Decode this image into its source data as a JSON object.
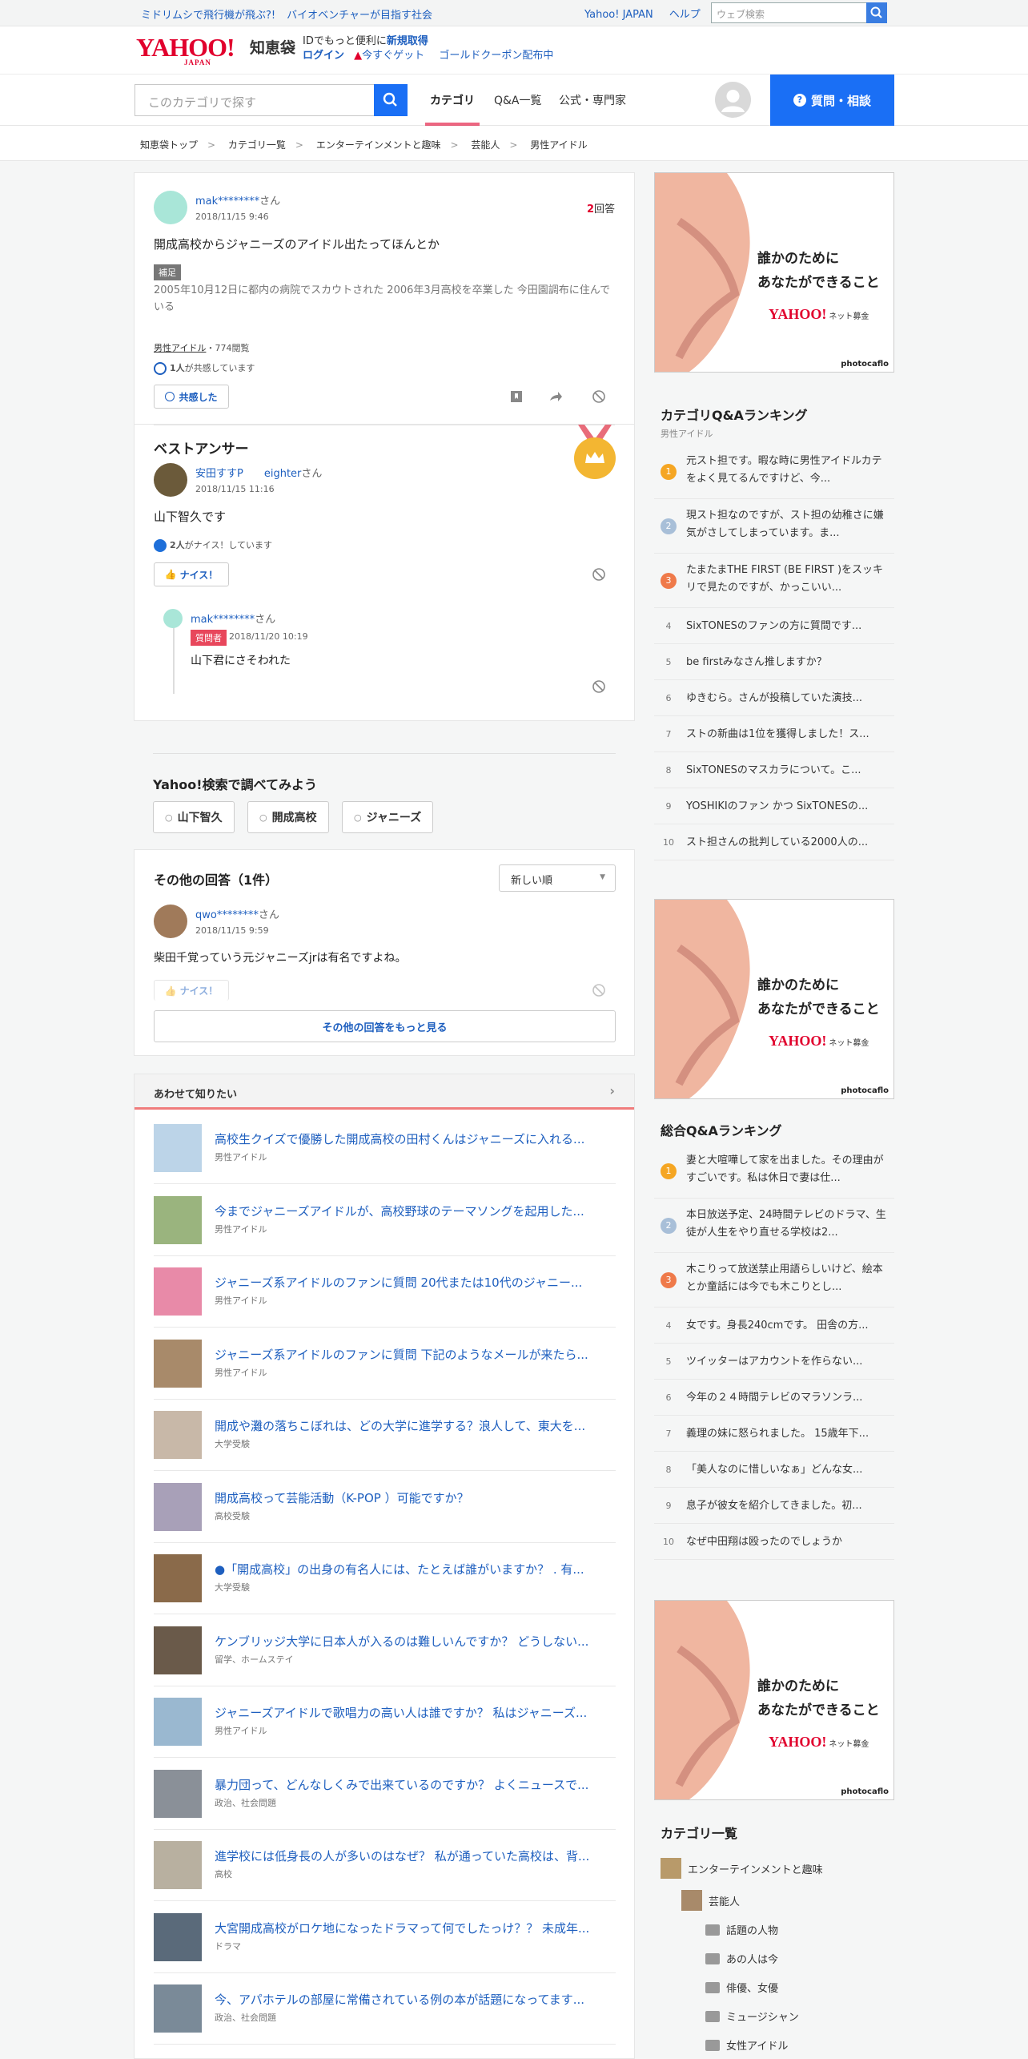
{
  "topbar": {
    "promo1": "ミドリムシで飛行機が飛ぶ?!",
    "promo2": "バイオベンチャーが目指す社会",
    "link1": "Yahoo! JAPAN",
    "link2": "ヘルプ",
    "search_placeholder": "ウェブ検索"
  },
  "header": {
    "logo": "YAHOO!",
    "logo_sub": "JAPAN",
    "service": "知恵袋",
    "promo_a": "IDでもっと便利に",
    "promo_b": "新規取得",
    "login": "ログイン",
    "get": "今すぐゲット",
    "gold": "ゴールドクーポン配布中"
  },
  "nav": {
    "search_placeholder": "このカテゴリで探す",
    "tab1": "カテゴリ",
    "tab2": "Q&A一覧",
    "tab3": "公式・専門家",
    "ask": "質問・相談"
  },
  "breadcrumb": [
    "知恵袋トップ",
    "カテゴリ一覧",
    "エンターテインメントと趣味",
    "芸能人",
    "男性アイドル"
  ],
  "question": {
    "user": "mak********",
    "san": "さん",
    "date": "2018/11/15 9:46",
    "answers_n": "2",
    "answers_label": "回答",
    "title": "開成高校からジャニーズのアイドル出たってほんとか",
    "supp_tag": "補足",
    "supp": "2005年10月12日に都内の病院でスカウトされた 2006年3月高校を卒業した 今田園調布に住んでいる",
    "category": "男性アイドル",
    "views": "・774閲覧",
    "empathy_n": "1人",
    "empathy_text": "が共感しています",
    "empathy_btn": "共感した"
  },
  "best": {
    "heading": "ベストアンサー",
    "user1": "安田すすP",
    "user2": "eighter",
    "san": "さん",
    "date": "2018/11/15 11:16",
    "text": "山下智久です",
    "nice_n": "2人",
    "nice_text": "がナイス！しています",
    "nice_btn": "ナイス！",
    "reply_user": "mak********",
    "reply_san": "さん",
    "reply_badge": "質問者",
    "reply_date": "2018/11/20 10:19",
    "reply_text": "山下君にさそわれた"
  },
  "search_section": {
    "title": "Yahoo!検索で調べてみよう",
    "chips": [
      "山下智久",
      "開成高校",
      "ジャニーズ"
    ]
  },
  "other": {
    "title": "その他の回答（1件）",
    "sort": "新しい順",
    "user": "qwo********",
    "san": "さん",
    "date": "2018/11/15 9:59",
    "text": "柴田千覚っていう元ジャニーズjrは有名ですよね。",
    "nice_btn": "ナイス！",
    "more": "その他の回答をもっと見る"
  },
  "related": {
    "title": "あわせて知りたい",
    "items": [
      {
        "t": "高校生クイズで優勝した開成高校の田村くんはジャニーズに入れる...",
        "c": "男性アイドル",
        "color": "#bcd4e8"
      },
      {
        "t": "今までジャニーズアイドルが、高校野球のテーマソングを起用した...",
        "c": "男性アイドル",
        "color": "#9ab47e"
      },
      {
        "t": "ジャニーズ系アイドルのファンに質問 20代または10代のジャニー...",
        "c": "男性アイドル",
        "color": "#e88aa8"
      },
      {
        "t": "ジャニーズ系アイドルのファンに質問 下記のようなメールが来たら...",
        "c": "男性アイドル",
        "color": "#a88a6a"
      },
      {
        "t": "開成や灘の落ちこぼれは、どの大学に進学する？浪人して、東大を...",
        "c": "大学受験",
        "color": "#c8b8a8"
      },
      {
        "t": "開成高校って芸能活動（K-POP ）可能ですか？",
        "c": "高校受験",
        "color": "#a8a0b8"
      },
      {
        "t": "●「開成高校」の出身の有名人には、たとえば誰がいますか？ . 有...",
        "c": "大学受験",
        "color": "#8a6a4a"
      },
      {
        "t": "ケンブリッジ大学に日本人が入るのは難しいんですか？ どうしない...",
        "c": "留学、ホームステイ",
        "color": "#6a5a4a"
      },
      {
        "t": "ジャニーズアイドルで歌唱力の高い人は誰ですか？ 私はジャニーズ...",
        "c": "男性アイドル",
        "color": "#9ab8d0"
      },
      {
        "t": "暴力団って、どんなしくみで出来ているのですか？ よくニュースで...",
        "c": "政治、社会問題",
        "color": "#8a9098"
      },
      {
        "t": "進学校には低身長の人が多いのはなぜ？ 私が通っていた高校は、背...",
        "c": "高校",
        "color": "#b8b0a0"
      },
      {
        "t": "大宮開成高校がロケ地になったドラマって何でしたっけ？？ 未成年...",
        "c": "ドラマ",
        "color": "#5a6a7a"
      },
      {
        "t": "今、アパホテルの部屋に常備されている例の本が話題になってます...",
        "c": "政治、社会問題",
        "color": "#7a8a98"
      }
    ]
  },
  "ad": {
    "line1": "誰かのために",
    "line2": "あなたができること",
    "logo": "YAHOO!",
    "logo_sub": "ネット募金",
    "credit": "photocaflo"
  },
  "cat_rank": {
    "title": "カテゴリQ&Aランキング",
    "sub": "男性アイドル",
    "items": [
      "元スト担です。暇な時に男性アイドルカテをよく見てるんですけど、今...",
      "現スト担なのですが、スト担の幼稚さに嫌気がさしてしまっています。ま...",
      "たまたまTHE FIRST (BE FIRST )をスッキリで見たのですが、かっこいい...",
      "SixTONESのファンの方に質問です...",
      "be firstみなさん推しますか？",
      "ゆきむら。さんが投稿していた演技...",
      "ストの新曲は1位を獲得しました！ス...",
      "SixTONESのマスカラについて。こ...",
      "YOSHIKIのファン かつ SixTONESの...",
      "スト担さんの批判している2000人の..."
    ]
  },
  "total_rank": {
    "title": "総合Q&Aランキング",
    "items": [
      "妻と大喧嘩して家を出ました。その理由がすごいです。私は休日で妻は仕...",
      "本日放送予定、24時間テレビのドラマ、生徒が人生をやり直せる学校は2...",
      "木こりって放送禁止用語らしいけど、絵本とか童話には今でも木こりとし...",
      "女です。身長240cmです。 田舎の方...",
      "ツイッターはアカウントを作らない...",
      "今年の２４時間テレビのマラソンラ...",
      "義理の妹に怒られました。 15歳年下...",
      "「美人なのに惜しいなぁ」どんな女...",
      "息子が彼女を紹介してきました。初...",
      "なぜ中田翔は殴ったのでしょうか"
    ]
  },
  "rank_colors": {
    "1": "#f5a623",
    "2": "#a8bfd8",
    "3": "#ef7a4a"
  },
  "categories": {
    "title": "カテゴリ一覧",
    "items": [
      "エンターテインメントと趣味",
      "芸能人",
      "話題の人物",
      "あの人は今",
      "俳優、女優",
      "ミュージシャン",
      "女性アイドル"
    ]
  }
}
